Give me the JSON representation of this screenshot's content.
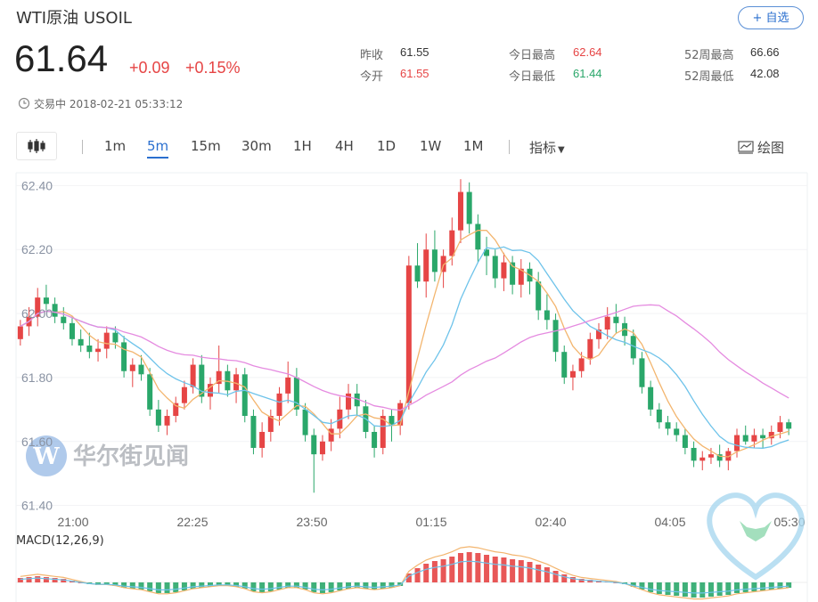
{
  "header": {
    "title": "WTI原油  USOIL",
    "follow_label": "+ 自选",
    "price": "61.64",
    "change": "+0.09",
    "change_pct": "+0.15%",
    "status": "交易中 2018-02-21 05:33:12"
  },
  "stats": [
    {
      "label": "昨收",
      "value": "61.55",
      "color": "#333333"
    },
    {
      "label": "今开",
      "value": "61.55",
      "color": "#e64545"
    },
    {
      "label": "今日最高",
      "value": "62.64",
      "color": "#e64545"
    },
    {
      "label": "今日最低",
      "value": "61.44",
      "color": "#2aa76a"
    },
    {
      "label": "52周最高",
      "value": "66.66",
      "color": "#333333"
    },
    {
      "label": "52周最低",
      "value": "42.08",
      "color": "#333333"
    }
  ],
  "toolbar": {
    "tabs": [
      "1m",
      "5m",
      "15m",
      "30m",
      "1H",
      "4H",
      "1D",
      "1W",
      "1M"
    ],
    "active_tab": "5m",
    "indicators_label": "指标",
    "draw_label": "绘图"
  },
  "watermark": "华尔街见闻",
  "colors": {
    "up": "#e64545",
    "down": "#2aa76a",
    "accent": "#2a6fcf",
    "ma_pink": "#e58be0",
    "ma_blue": "#6ec3ea",
    "ma_orange": "#f3b56e"
  },
  "chart_data": {
    "type": "candlestick",
    "interval": "5m",
    "x_tick_labels": [
      "21:00",
      "22:25",
      "23:50",
      "01:15",
      "02:40",
      "04:05",
      "05:30"
    ],
    "y_tick_labels": [
      "62.40",
      "62.20",
      "62.00",
      "61.80",
      "61.60",
      "61.40"
    ],
    "ylim": [
      61.36,
      62.44
    ],
    "candles": [
      [
        61.92,
        61.98,
        61.9,
        61.96
      ],
      [
        61.96,
        62.02,
        61.93,
        61.99
      ],
      [
        61.99,
        62.08,
        61.96,
        62.05
      ],
      [
        62.05,
        62.09,
        62.01,
        62.03
      ],
      [
        62.03,
        62.05,
        61.97,
        61.99
      ],
      [
        61.99,
        62.02,
        61.95,
        61.97
      ],
      [
        61.97,
        61.99,
        61.9,
        61.92
      ],
      [
        61.92,
        61.95,
        61.88,
        61.9
      ],
      [
        61.9,
        61.94,
        61.86,
        61.88
      ],
      [
        61.88,
        61.92,
        61.85,
        61.89
      ],
      [
        61.89,
        61.96,
        61.86,
        61.94
      ],
      [
        61.94,
        61.96,
        61.89,
        61.91
      ],
      [
        61.91,
        61.93,
        61.8,
        61.82
      ],
      [
        61.82,
        61.86,
        61.77,
        61.84
      ],
      [
        61.84,
        61.87,
        61.79,
        61.81
      ],
      [
        61.81,
        61.83,
        61.68,
        61.7
      ],
      [
        61.7,
        61.73,
        61.63,
        61.65
      ],
      [
        61.65,
        61.7,
        61.62,
        61.68
      ],
      [
        61.68,
        61.74,
        61.66,
        61.72
      ],
      [
        61.72,
        61.79,
        61.7,
        61.77
      ],
      [
        61.77,
        61.86,
        61.75,
        61.84
      ],
      [
        61.84,
        61.87,
        61.72,
        61.74
      ],
      [
        61.74,
        61.8,
        61.7,
        61.78
      ],
      [
        61.78,
        61.9,
        61.75,
        61.82
      ],
      [
        61.82,
        61.84,
        61.74,
        61.76
      ],
      [
        61.76,
        61.83,
        61.72,
        61.81
      ],
      [
        61.81,
        61.83,
        61.66,
        61.68
      ],
      [
        61.68,
        61.7,
        61.56,
        61.58
      ],
      [
        61.58,
        61.66,
        61.55,
        61.63
      ],
      [
        61.63,
        61.7,
        61.6,
        61.68
      ],
      [
        61.68,
        61.77,
        61.65,
        61.75
      ],
      [
        61.75,
        61.85,
        61.72,
        61.8
      ],
      [
        61.8,
        61.83,
        61.68,
        61.7
      ],
      [
        61.7,
        61.72,
        61.6,
        61.62
      ],
      [
        61.62,
        61.64,
        61.44,
        61.56
      ],
      [
        61.56,
        61.62,
        61.54,
        61.6
      ],
      [
        61.6,
        61.67,
        61.57,
        61.64
      ],
      [
        61.64,
        61.74,
        61.61,
        61.7
      ],
      [
        61.7,
        61.78,
        61.67,
        61.75
      ],
      [
        61.75,
        61.78,
        61.68,
        61.71
      ],
      [
        61.71,
        61.73,
        61.61,
        61.63
      ],
      [
        61.63,
        61.65,
        61.55,
        61.58
      ],
      [
        61.58,
        61.7,
        61.56,
        61.68
      ],
      [
        61.68,
        61.7,
        61.6,
        61.65
      ],
      [
        61.65,
        61.73,
        61.62,
        61.72
      ],
      [
        61.72,
        62.18,
        61.7,
        62.15
      ],
      [
        62.15,
        62.22,
        62.08,
        62.1
      ],
      [
        62.1,
        62.25,
        62.05,
        62.2
      ],
      [
        62.2,
        62.26,
        62.1,
        62.13
      ],
      [
        62.13,
        62.2,
        62.08,
        62.18
      ],
      [
        62.18,
        62.3,
        62.15,
        62.26
      ],
      [
        62.26,
        62.42,
        62.22,
        62.38
      ],
      [
        62.38,
        62.41,
        62.25,
        62.28
      ],
      [
        62.28,
        62.31,
        62.16,
        62.2
      ],
      [
        62.2,
        62.24,
        62.12,
        62.18
      ],
      [
        62.18,
        62.2,
        62.08,
        62.11
      ],
      [
        62.11,
        62.19,
        62.07,
        62.16
      ],
      [
        62.16,
        62.18,
        62.06,
        62.09
      ],
      [
        62.09,
        62.17,
        62.05,
        62.14
      ],
      [
        62.14,
        62.16,
        62.06,
        62.1
      ],
      [
        62.1,
        62.13,
        61.98,
        62.01
      ],
      [
        62.01,
        62.06,
        61.95,
        61.98
      ],
      [
        61.98,
        62.0,
        61.85,
        61.88
      ],
      [
        61.88,
        61.9,
        61.78,
        61.8
      ],
      [
        61.8,
        61.84,
        61.76,
        61.82
      ],
      [
        61.82,
        61.88,
        61.8,
        61.86
      ],
      [
        61.86,
        61.94,
        61.84,
        61.92
      ],
      [
        61.92,
        61.97,
        61.89,
        61.95
      ],
      [
        61.95,
        62.02,
        61.92,
        61.99
      ],
      [
        61.99,
        62.03,
        61.94,
        61.97
      ],
      [
        61.97,
        61.99,
        61.9,
        61.93
      ],
      [
        61.93,
        61.95,
        61.84,
        61.86
      ],
      [
        61.86,
        61.88,
        61.75,
        61.77
      ],
      [
        61.77,
        61.79,
        61.68,
        61.7
      ],
      [
        61.7,
        61.72,
        61.64,
        61.66
      ],
      [
        61.66,
        61.68,
        61.62,
        61.64
      ],
      [
        61.64,
        61.66,
        61.6,
        61.62
      ],
      [
        61.62,
        61.64,
        61.56,
        61.58
      ],
      [
        61.58,
        61.6,
        61.52,
        61.54
      ],
      [
        61.54,
        61.57,
        61.51,
        61.55
      ],
      [
        61.55,
        61.58,
        61.53,
        61.56
      ],
      [
        61.56,
        61.59,
        61.52,
        61.54
      ],
      [
        61.54,
        61.58,
        61.51,
        61.57
      ],
      [
        61.57,
        61.64,
        61.55,
        61.62
      ],
      [
        61.62,
        61.65,
        61.59,
        61.6
      ],
      [
        61.6,
        61.64,
        61.58,
        61.62
      ],
      [
        61.62,
        61.64,
        61.58,
        61.61
      ],
      [
        61.61,
        61.65,
        61.59,
        61.63
      ],
      [
        61.63,
        61.68,
        61.61,
        61.66
      ],
      [
        61.66,
        61.67,
        61.62,
        61.64
      ]
    ],
    "moving_averages": [
      {
        "color": "#f3b56e",
        "period": 5
      },
      {
        "color": "#6ec3ea",
        "period": 10
      },
      {
        "color": "#e58be0",
        "period": 30
      }
    ],
    "macd": {
      "label": "MACD(12,26,9)",
      "hist": [
        0.005,
        0.006,
        0.007,
        0.006,
        0.005,
        0.004,
        0.002,
        0.0,
        -0.002,
        -0.003,
        -0.003,
        -0.004,
        -0.006,
        -0.007,
        -0.008,
        -0.01,
        -0.012,
        -0.012,
        -0.011,
        -0.009,
        -0.007,
        -0.006,
        -0.005,
        -0.004,
        -0.004,
        -0.005,
        -0.007,
        -0.01,
        -0.011,
        -0.01,
        -0.008,
        -0.006,
        -0.006,
        -0.008,
        -0.011,
        -0.012,
        -0.011,
        -0.009,
        -0.007,
        -0.006,
        -0.007,
        -0.008,
        -0.007,
        -0.006,
        -0.004,
        0.01,
        0.016,
        0.021,
        0.024,
        0.026,
        0.029,
        0.033,
        0.034,
        0.033,
        0.031,
        0.029,
        0.028,
        0.026,
        0.025,
        0.023,
        0.02,
        0.017,
        0.013,
        0.009,
        0.006,
        0.004,
        0.003,
        0.002,
        0.001,
        0.0,
        -0.002,
        -0.005,
        -0.008,
        -0.011,
        -0.013,
        -0.014,
        -0.015,
        -0.016,
        -0.017,
        -0.017,
        -0.016,
        -0.015,
        -0.014,
        -0.012,
        -0.011,
        -0.01,
        -0.009,
        -0.008,
        -0.007,
        -0.006
      ],
      "ylim": [
        -0.02,
        0.036
      ]
    }
  }
}
